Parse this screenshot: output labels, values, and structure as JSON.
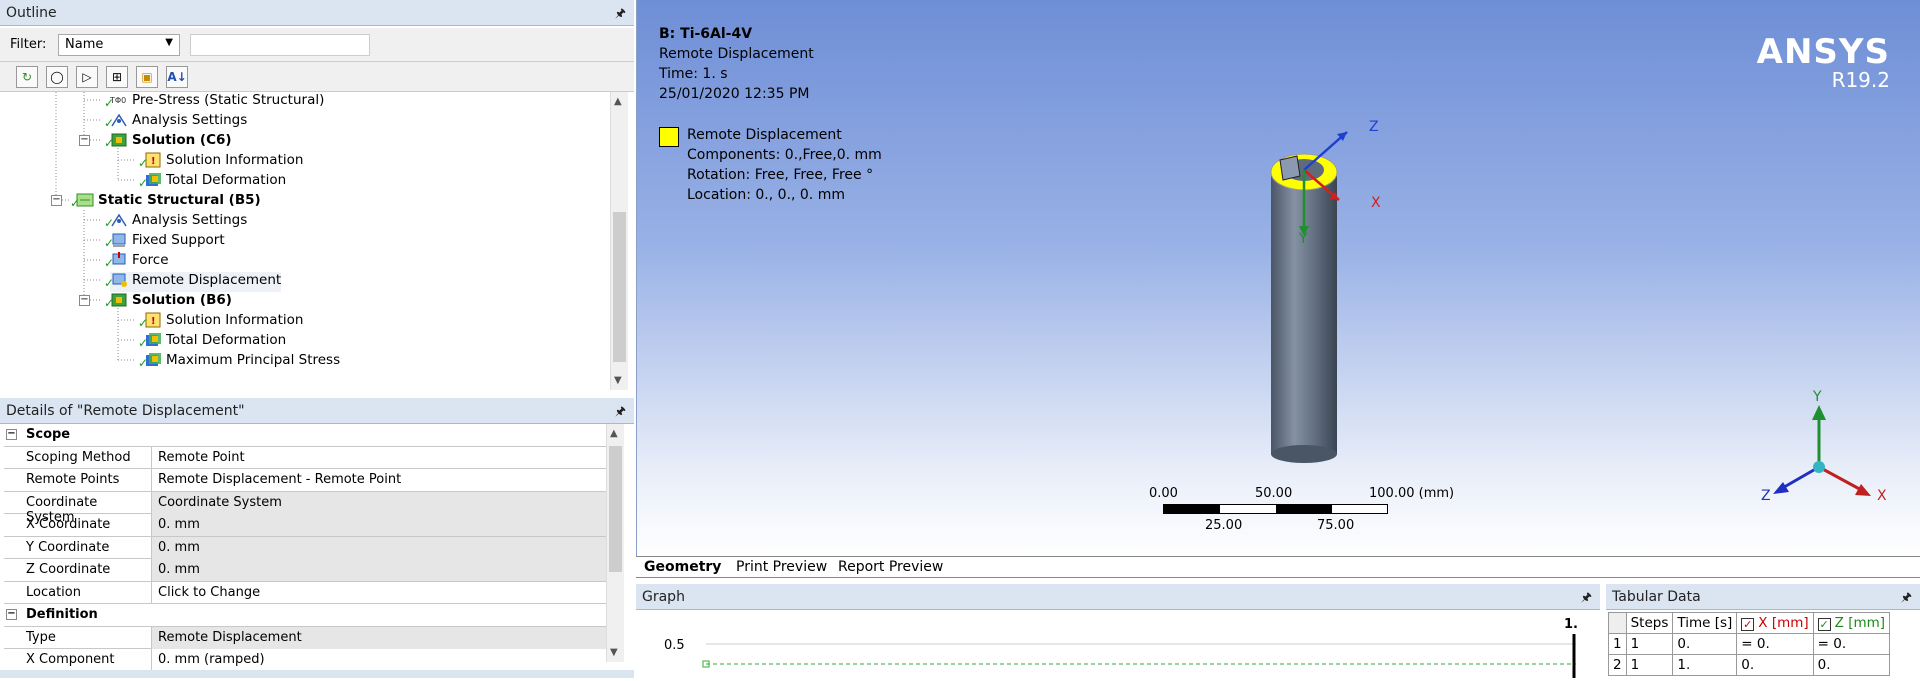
{
  "outline": {
    "title": "Outline",
    "filter_label": "Filter:",
    "filter_value": "Name",
    "tree": [
      {
        "label": "Pre-Stress (Static Structural)",
        "icon": "prestress-icon",
        "bold": false
      },
      {
        "label": "Analysis Settings",
        "icon": "analysis-settings-icon",
        "bold": false
      },
      {
        "label": "Solution (C6)",
        "icon": "solution-icon",
        "bold": true
      },
      {
        "label": "Solution Information",
        "icon": "solution-info-icon",
        "bold": false
      },
      {
        "label": "Total Deformation",
        "icon": "result-icon",
        "bold": false
      },
      {
        "label": "Static Structural (B5)",
        "icon": "static-structural-icon",
        "bold": true
      },
      {
        "label": "Analysis Settings",
        "icon": "analysis-settings-icon",
        "bold": false
      },
      {
        "label": "Fixed Support",
        "icon": "fixed-support-icon",
        "bold": false
      },
      {
        "label": "Force",
        "icon": "force-icon",
        "bold": false
      },
      {
        "label": "Remote Displacement",
        "icon": "remote-displacement-icon",
        "bold": false
      },
      {
        "label": "Solution (B6)",
        "icon": "solution-icon",
        "bold": true
      },
      {
        "label": "Solution Information",
        "icon": "solution-info-icon",
        "bold": false
      },
      {
        "label": "Total Deformation",
        "icon": "result-icon",
        "bold": false
      },
      {
        "label": "Maximum Principal Stress",
        "icon": "result-icon",
        "bold": false
      }
    ]
  },
  "details": {
    "title": "Details of \"Remote Displacement\"",
    "rows": [
      {
        "section": "Scope"
      },
      {
        "key": "Scoping Method",
        "value": "Remote Point",
        "gray": false
      },
      {
        "key": "Remote Points",
        "value": "Remote Displacement - Remote Point",
        "gray": false
      },
      {
        "key": "Coordinate System",
        "value": "Coordinate System",
        "gray": true
      },
      {
        "key": "X Coordinate",
        "value": "0. mm",
        "gray": true
      },
      {
        "key": "Y Coordinate",
        "value": "0. mm",
        "gray": true
      },
      {
        "key": "Z Coordinate",
        "value": "0. mm",
        "gray": true
      },
      {
        "key": "Location",
        "value": "Click to Change",
        "gray": false
      },
      {
        "section": "Definition"
      },
      {
        "key": "Type",
        "value": "Remote Displacement",
        "gray": true
      },
      {
        "key": "X Component",
        "value": "0. mm  (ramped)",
        "gray": false
      }
    ]
  },
  "viewport": {
    "legend_title": "B: Ti-6Al-4V",
    "legend_subtitle": "Remote Displacement",
    "legend_time": "Time: 1. s",
    "legend_date": "25/01/2020 12:35 PM",
    "entry_name": "Remote Displacement",
    "entry_components": "Components: 0.,Free,0. mm",
    "entry_rotation": "Rotation: Free, Free, Free °",
    "entry_location": "Location: 0., 0., 0. mm",
    "brand": "ANSYS",
    "version": "R19.2",
    "triad_x": "X",
    "triad_y": "Y",
    "triad_z": "Z",
    "scale_labels_top": [
      "0.00",
      "50.00",
      "100.00 (mm)"
    ],
    "scale_labels_bottom": [
      "25.00",
      "75.00"
    ],
    "highlight_color": "#ffff00"
  },
  "view_tabs": [
    "Geometry",
    "Print Preview",
    "Report Preview"
  ],
  "graph": {
    "title": "Graph",
    "y_tick": "0.5",
    "x_marker": "1."
  },
  "tabular": {
    "title": "Tabular Data",
    "headers": [
      "Steps",
      "Time [s]",
      "X [mm]",
      "Z [mm]"
    ],
    "rows": [
      [
        "1",
        "1",
        "0.",
        "= 0.",
        "= 0."
      ],
      [
        "2",
        "1",
        "1.",
        "0.",
        "0."
      ]
    ]
  }
}
